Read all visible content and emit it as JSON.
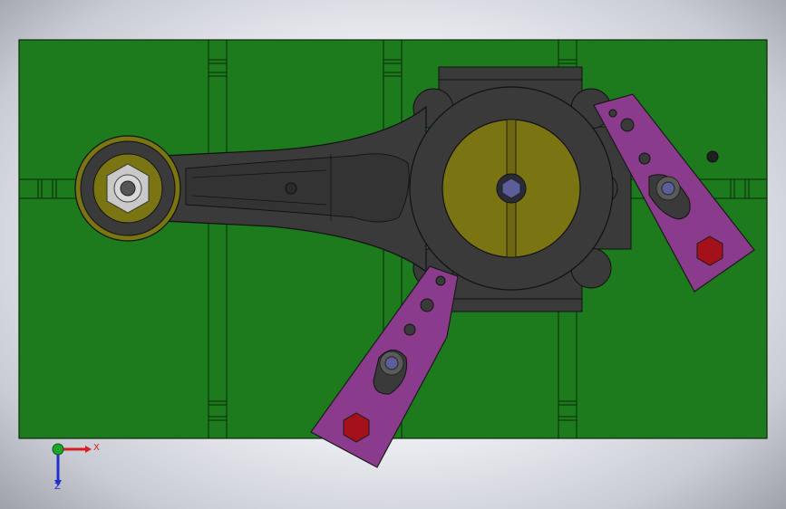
{
  "viewport": {
    "background": "gradient-gray",
    "triad": {
      "x_label": "X",
      "z_label": "Z"
    }
  },
  "colors": {
    "base_plate": "#1d7a1d",
    "rod_body": "#3a3a3a",
    "bearing_yellow": "#7a7512",
    "clamp_purple": "#8b3b8c",
    "bolt_head_red": "#a3111b",
    "axis_x": "#d42020",
    "axis_y": "#1fa32b",
    "axis_z": "#2030c8"
  },
  "parts": [
    {
      "name": "base-plate",
      "color": "green"
    },
    {
      "name": "connecting-rod",
      "color": "dark-gray"
    },
    {
      "name": "small-end-bearing",
      "color": "yellow"
    },
    {
      "name": "big-end-bearing",
      "color": "yellow"
    },
    {
      "name": "clamp-arm-right",
      "color": "purple"
    },
    {
      "name": "clamp-arm-lower",
      "color": "purple"
    }
  ]
}
